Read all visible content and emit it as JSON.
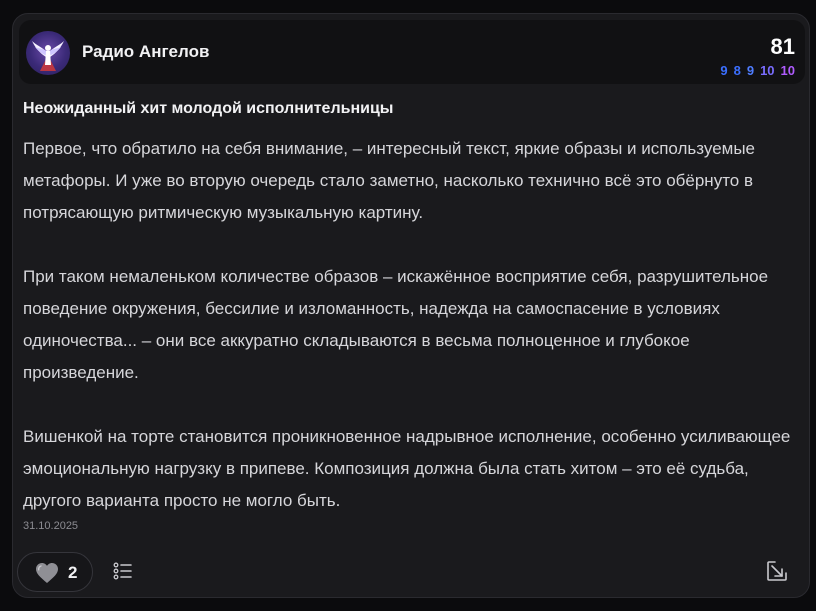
{
  "post": {
    "station_name": "Радио Ангелов",
    "score": "81",
    "subscores": [
      {
        "value": "9",
        "color": "#3b6fff"
      },
      {
        "value": "8",
        "color": "#3b6fff"
      },
      {
        "value": "9",
        "color": "#4f7dff"
      },
      {
        "value": "10",
        "color": "#7a6dff"
      },
      {
        "value": "10",
        "color": "#b05cff"
      }
    ],
    "title": "Неожиданный хит молодой исполнительницы",
    "paragraphs": [
      "Первое, что обратило на себя внимание, – интересный текст, яркие образы и используемые метафоры. И уже во вторую очередь стало заметно, насколько технично всё это обёрнуто в потрясающую ритмическую музыкальную картину.",
      "При таком немаленьком количестве образов – искажённое восприятие себя, разрушительное поведение окружения, бессилие и изломанность, надежда на самоспасение в условиях одиночества... – они все аккуратно складываются в весьма полноценное и глубокое произведение.",
      "Вишенкой на торте становится проникновенное надрывное исполнение, особенно усиливающее эмоциональную нагрузку в припеве. Композиция должна была стать хитом – это её судьба, другого варианта просто не могло быть."
    ],
    "date": "31.10.2025",
    "likes": "2"
  },
  "icons": {
    "avatar": "angel-logo-icon",
    "like": "heart-icon",
    "list": "list-icon",
    "share": "external-link-icon"
  }
}
